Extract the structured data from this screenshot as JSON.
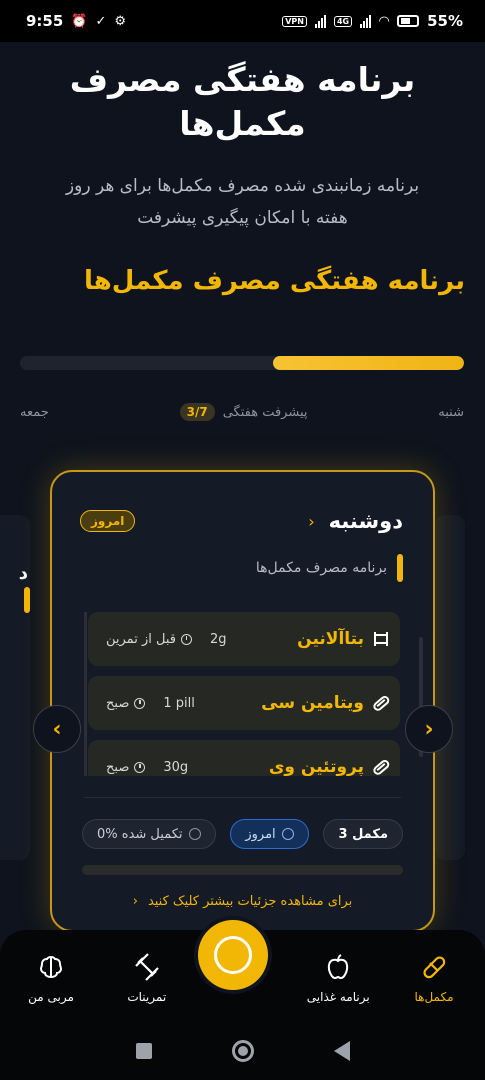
{
  "status_bar": {
    "time": "9:55",
    "vpn_label": "VPN",
    "network_label": "4G",
    "battery": "55%"
  },
  "header": {
    "title": "برنامه هفتگی مصرف مکمل‌ها",
    "subtitle": "برنامه زمانبندی شده مصرف مکمل‌ها برای هر روز هفته با امکان پیگیری پیشرفت"
  },
  "section": {
    "title": "برنامه هفتگی مصرف مکمل‌ها"
  },
  "weekly_progress": {
    "label": "پیشرفت هفتگی",
    "fraction_text": "3/7",
    "fraction_value": 0.43,
    "start_day": "شنبه",
    "end_day": "جمعه"
  },
  "side_card_left": {
    "peek_text": "د"
  },
  "day_card": {
    "day_name": "دوشنبه",
    "today_badge": "امروز",
    "plan_label": "برنامه مصرف مکمل‌ها",
    "supplements": [
      {
        "name": "بتاآلانین",
        "amount": "2g",
        "time": "قبل از تمرین",
        "icon": "dumbbell-icon"
      },
      {
        "name": "ویتامین سی",
        "amount": "1 pill",
        "time": "صبح",
        "icon": "pill-icon"
      },
      {
        "name": "پروتئین وی",
        "amount": "30g",
        "time": "صبح",
        "icon": "pill-icon"
      }
    ],
    "stats": {
      "count": "3 مکمل",
      "today": "امروز",
      "completed": "0% تکمیل شده"
    },
    "details_link": "برای مشاهده جزئیات بیشتر کلیک کنید"
  },
  "bottom_nav": {
    "items": [
      {
        "label": "مکمل‌ها",
        "icon": "pill-icon",
        "active": true
      },
      {
        "label": "برنامه غذایی",
        "icon": "apple-icon",
        "active": false
      },
      {
        "label": "تمرینات",
        "icon": "dumbbell-icon",
        "active": false
      },
      {
        "label": "مربی من",
        "icon": "brain-icon",
        "active": false
      }
    ]
  },
  "colors": {
    "accent": "#f2b705",
    "background": "#0e131d",
    "card": "#141a26",
    "item": "#262823",
    "blue_chip": "#12305a"
  }
}
